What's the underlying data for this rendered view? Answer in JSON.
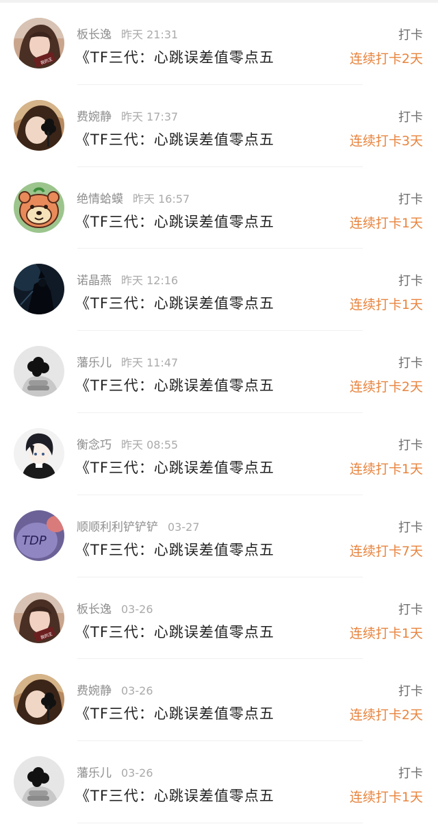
{
  "colors": {
    "streak": "#e8843e",
    "name": "#8e8e8e",
    "time": "#aaaaaa",
    "title": "#222222",
    "divider": "#f0f0f0"
  },
  "entries": [
    {
      "user": "板长逸",
      "time": "昨天 21:31",
      "title": "《TF三代：心跳误差值零点五",
      "action": "打卡",
      "streak": "连续打卡2天",
      "avatar": "avatar-girl-photo"
    },
    {
      "user": "费婉静",
      "time": "昨天 17:37",
      "title": "《TF三代：心跳误差值零点五",
      "action": "打卡",
      "streak": "连续打卡3天",
      "avatar": "avatar-flower-face"
    },
    {
      "user": "绝情蛤蟆",
      "time": "昨天 16:57",
      "title": "《TF三代：心跳误差值零点五",
      "action": "打卡",
      "streak": "连续打卡1天",
      "avatar": "avatar-cartoon-bear"
    },
    {
      "user": "诺晶燕",
      "time": "昨天 12:16",
      "title": "《TF三代：心跳误差值零点五",
      "action": "打卡",
      "streak": "连续打卡1天",
      "avatar": "avatar-dark-night"
    },
    {
      "user": "藩乐儿",
      "time": "昨天 11:47",
      "title": "《TF三代：心跳误差值零点五",
      "action": "打卡",
      "streak": "连续打卡2天",
      "avatar": "avatar-hand-flower"
    },
    {
      "user": "衡念巧",
      "time": "昨天 08:55",
      "title": "《TF三代：心跳误差值零点五",
      "action": "打卡",
      "streak": "连续打卡1天",
      "avatar": "avatar-anime-boy"
    },
    {
      "user": "顺顺利利铲铲铲",
      "time": "03-27",
      "title": "《TF三代：心跳误差值零点五",
      "action": "打卡",
      "streak": "连续打卡7天",
      "avatar": "avatar-purple-tdp"
    },
    {
      "user": "板长逸",
      "time": "03-26",
      "title": "《TF三代：心跳误差值零点五",
      "action": "打卡",
      "streak": "连续打卡1天",
      "avatar": "avatar-girl-photo"
    },
    {
      "user": "费婉静",
      "time": "03-26",
      "title": "《TF三代：心跳误差值零点五",
      "action": "打卡",
      "streak": "连续打卡2天",
      "avatar": "avatar-flower-face"
    },
    {
      "user": "藩乐儿",
      "time": "03-26",
      "title": "《TF三代：心跳误差值零点五",
      "action": "打卡",
      "streak": "连续打卡1天",
      "avatar": "avatar-hand-flower"
    }
  ]
}
